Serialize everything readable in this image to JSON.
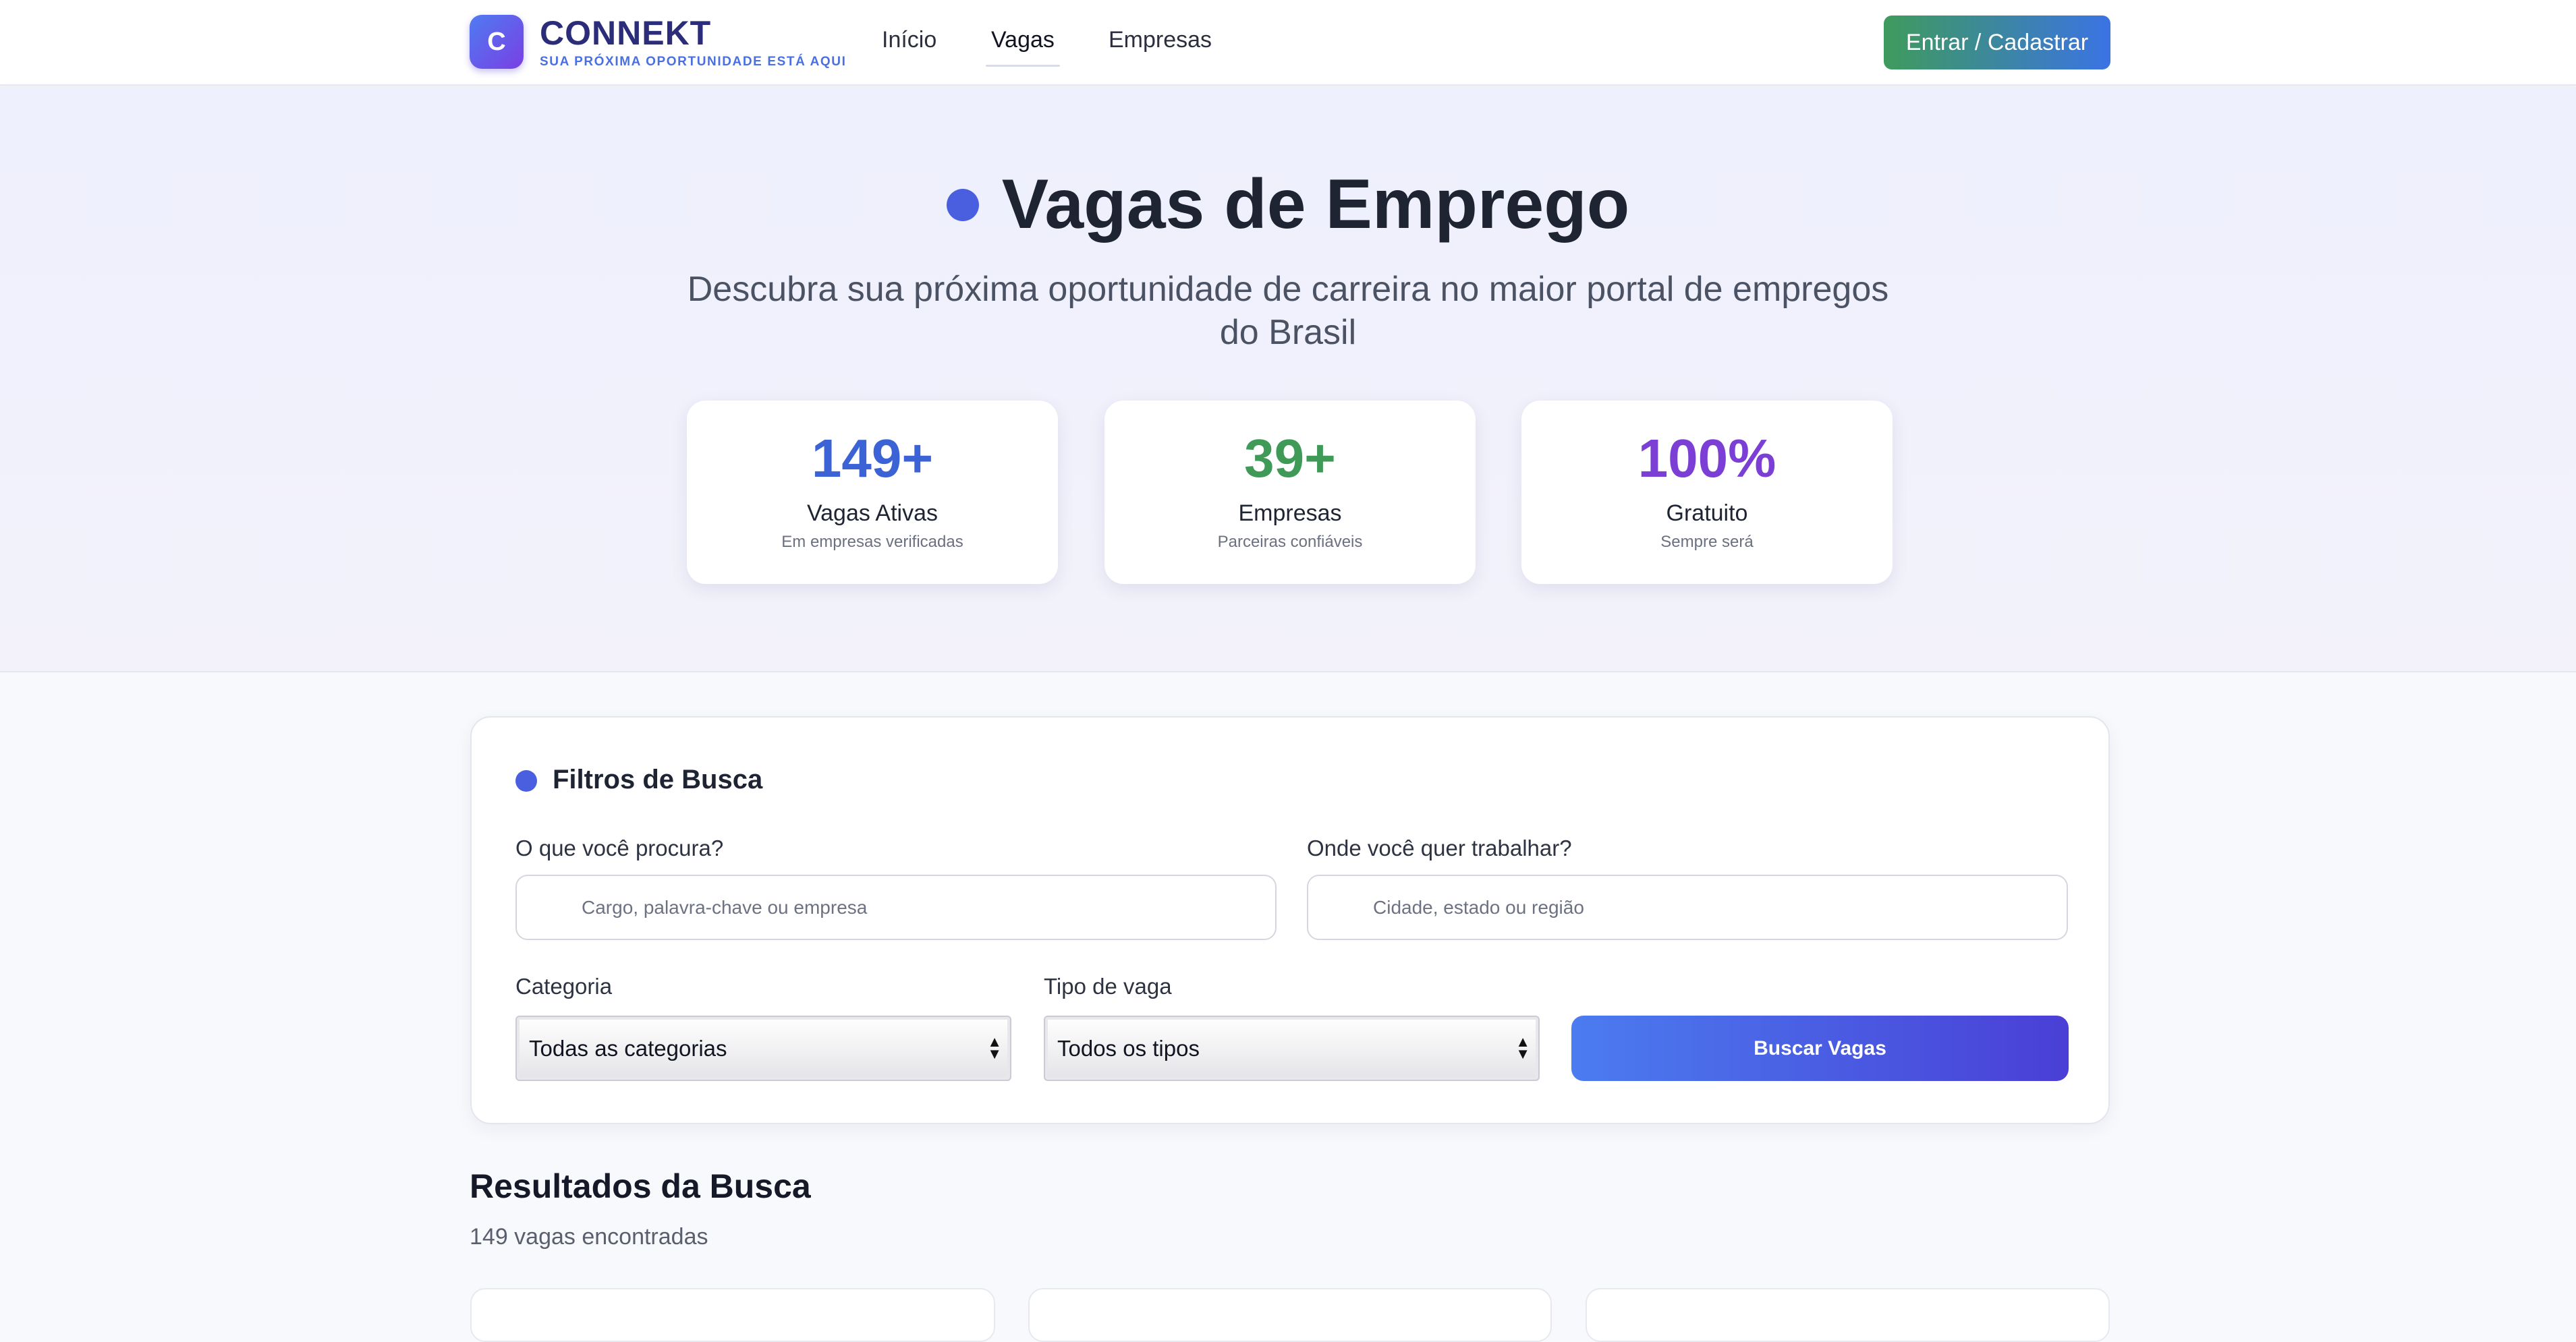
{
  "nav": {
    "logo_letter": "C",
    "brand": "CONNEKT",
    "tagline": "SUA PRÓXIMA OPORTUNIDADE ESTÁ AQUI",
    "links": [
      "Início",
      "Vagas",
      "Empresas"
    ],
    "active_link": "Vagas",
    "login_button": "Entrar / Cadastrar"
  },
  "hero": {
    "title": "Vagas de Emprego",
    "subtitle": "Descubra sua próxima oportunidade de carreira no maior portal de empregos do Brasil",
    "stats": [
      {
        "value": "149+",
        "label": "Vagas Ativas",
        "desc": "Em empresas verificadas",
        "color": "#3b63d6"
      },
      {
        "value": "39+",
        "label": "Empresas",
        "desc": "Parceiras confiáveis",
        "color": "#3f9a58"
      },
      {
        "value": "100%",
        "label": "Gratuito",
        "desc": "Sempre será",
        "color": "#7b3fd6"
      }
    ]
  },
  "filters": {
    "title": "Filtros de Busca",
    "what_label": "O que você procura?",
    "what_placeholder": "Cargo, palavra-chave ou empresa",
    "where_label": "Onde você quer trabalhar?",
    "where_placeholder": "Cidade, estado ou região",
    "category_label": "Categoria",
    "category_value": "Todas as categorias",
    "type_label": "Tipo de vaga",
    "type_value": "Todos os tipos",
    "search_button": "Buscar Vagas"
  },
  "results": {
    "title": "Resultados da Busca",
    "count": "149 vagas encontradas"
  },
  "colors": {
    "accent": "#4a5fe0",
    "login_gradient_start": "#3e9b5c",
    "login_gradient_end": "#3b73e4"
  }
}
